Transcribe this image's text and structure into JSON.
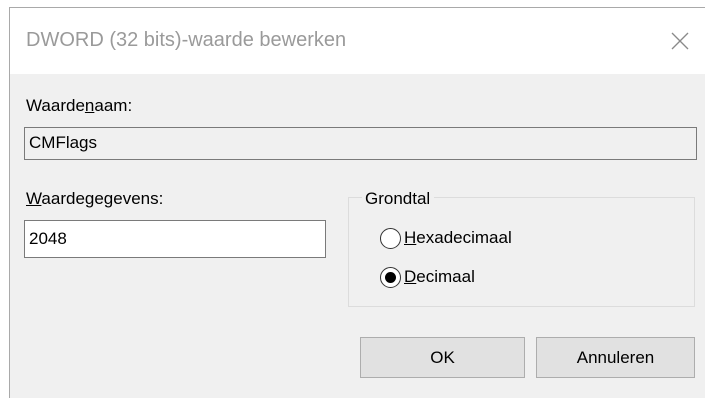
{
  "dialog": {
    "title": "DWORD (32 bits)-waarde bewerken",
    "close_icon": "close-icon"
  },
  "value_name": {
    "label_pre": "Waarde",
    "label_accel": "n",
    "label_post": "aam:",
    "value": "CMFlags"
  },
  "value_data": {
    "label_accel": "W",
    "label_post": "aardegegevens:",
    "value": "2048"
  },
  "base": {
    "legend": "Grondtal",
    "options": [
      {
        "accel": "H",
        "rest": "exadecimaal",
        "selected": false
      },
      {
        "accel": "D",
        "rest": "ecimaal",
        "selected": true
      }
    ]
  },
  "buttons": {
    "ok_label": "OK",
    "cancel_label": "Annuleren"
  }
}
